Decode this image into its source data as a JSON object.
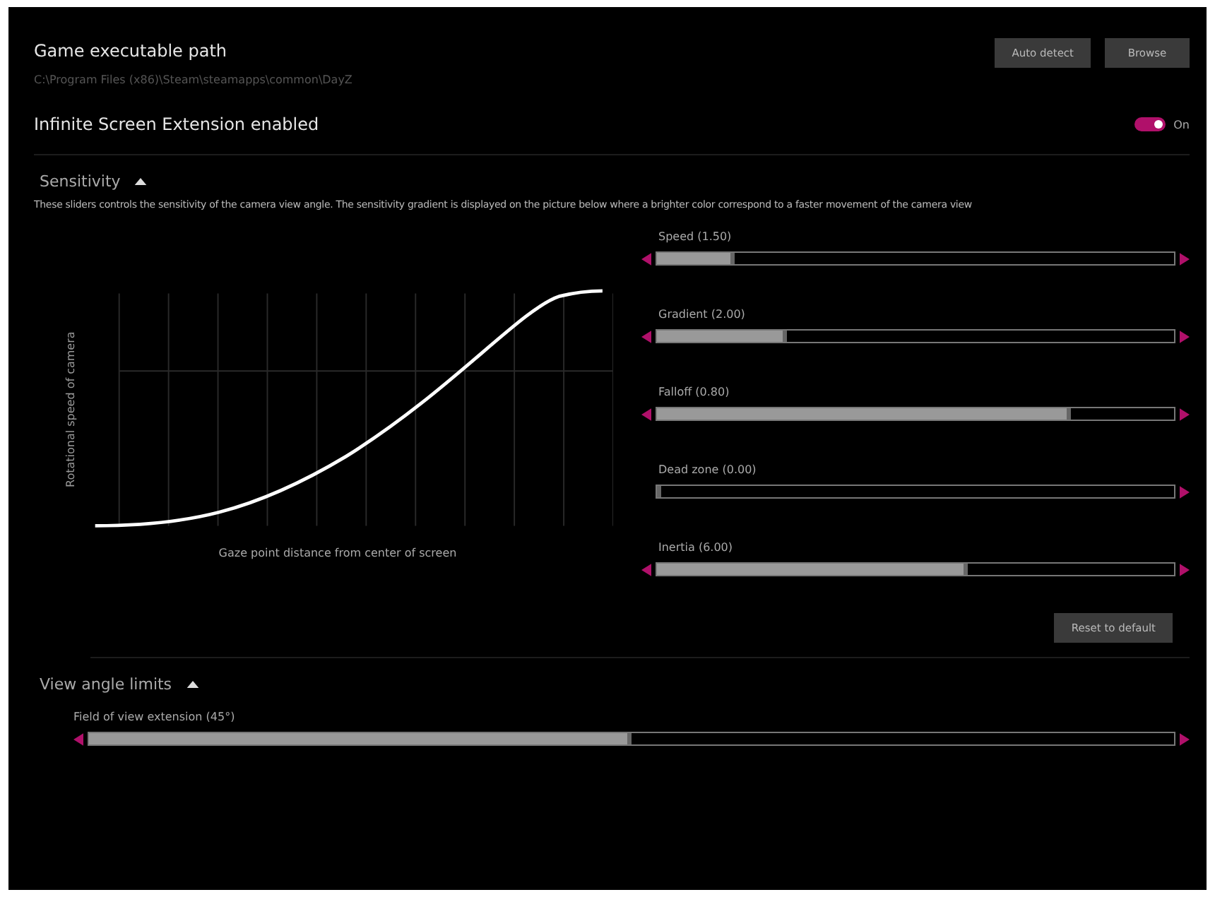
{
  "game_path": {
    "label": "Game executable path",
    "value": "C:\\Program Files (x86)\\Steam\\steamapps\\common\\DayZ",
    "buttons": [
      "Auto detect",
      "Browse"
    ]
  },
  "extension": {
    "label": "Infinite Screen Extension enabled",
    "on": true,
    "state_text": "On"
  },
  "sensitivity": {
    "title": "Sensitivity",
    "expanded": true,
    "description": "These sliders controls the sensitivity of the camera view angle. The sensitivity gradient is displayed on the picture below where a brighter color correspond to a faster movement of the camera view",
    "graph": {
      "xlabel": "Gaze point distance from center of screen",
      "ylabel": "Rotational speed of camera"
    },
    "sliders": [
      {
        "label": "Speed (1.50)",
        "level": 0.15,
        "can_decrease": true,
        "can_increase": true
      },
      {
        "label": "Gradient (2.00)",
        "level": 0.25,
        "can_decrease": true,
        "can_increase": true
      },
      {
        "label": "Falloff (0.80)",
        "level": 0.8,
        "can_decrease": true,
        "can_increase": true
      },
      {
        "label": "Dead zone (0.00)",
        "level": 0.0,
        "can_decrease": false,
        "can_increase": true
      },
      {
        "label": "Inertia (6.00)",
        "level": 0.6,
        "can_decrease": true,
        "can_increase": true
      }
    ],
    "reset_button": "Reset to default"
  },
  "view_angle": {
    "title": "View angle limits",
    "expanded": true,
    "sliders": [
      {
        "label": "Field of view extension (45°)",
        "level": 0.5,
        "can_decrease": true,
        "can_increase": true
      }
    ]
  }
}
